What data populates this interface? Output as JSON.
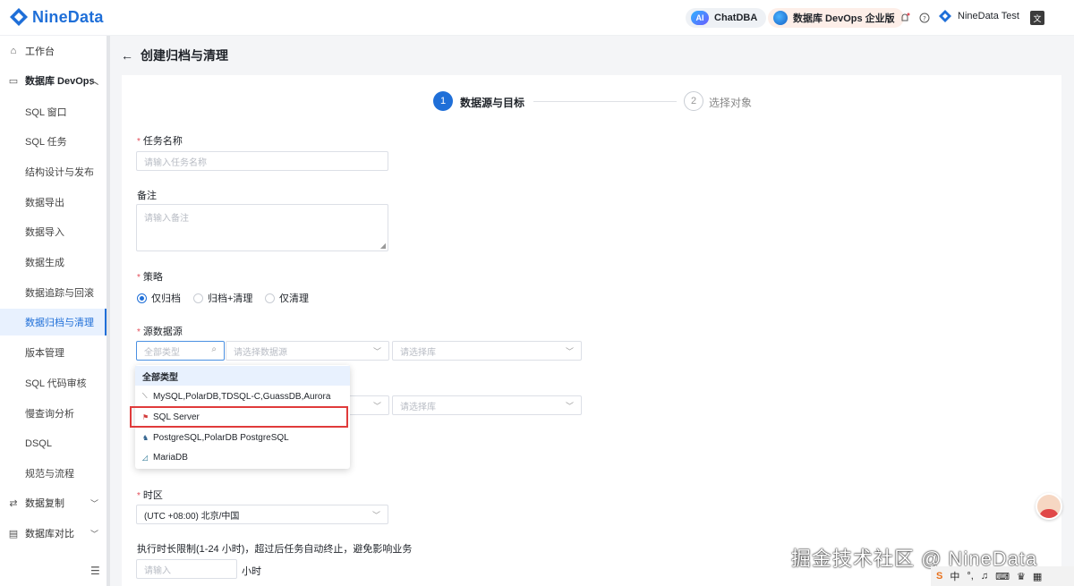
{
  "brand": {
    "name": "NineData"
  },
  "topbar": {
    "chatdba_badge": "AI",
    "chatdba_label": "ChatDBA",
    "edition_label": "数据库 DevOps 企业版",
    "user_name": "NineData Test",
    "lang_badge": "文"
  },
  "sidebar": {
    "items": [
      {
        "label": "工作台"
      },
      {
        "label": "数据库 DevOps"
      },
      {
        "label": "SQL 窗口"
      },
      {
        "label": "SQL 任务"
      },
      {
        "label": "结构设计与发布"
      },
      {
        "label": "数据导出"
      },
      {
        "label": "数据导入"
      },
      {
        "label": "数据生成"
      },
      {
        "label": "数据追踪与回滚"
      },
      {
        "label": "数据归档与清理"
      },
      {
        "label": "版本管理"
      },
      {
        "label": "SQL 代码审核"
      },
      {
        "label": "慢查询分析"
      },
      {
        "label": "DSQL"
      },
      {
        "label": "规范与流程"
      },
      {
        "label": "数据复制"
      },
      {
        "label": "数据库对比"
      }
    ]
  },
  "page": {
    "title": "创建归档与清理",
    "steps": [
      {
        "num": "1",
        "label": "数据源与目标"
      },
      {
        "num": "2",
        "label": "选择对象"
      }
    ]
  },
  "form": {
    "task_name_label": "任务名称",
    "task_name_placeholder": "请输入任务名称",
    "remark_label": "备注",
    "remark_placeholder": "请输入备注",
    "strategy_label": "策略",
    "strategy_options": [
      "仅归档",
      "归档+清理",
      "仅清理"
    ],
    "strategy_selected": "仅归档",
    "source_label": "源数据源",
    "type_placeholder": "全部类型",
    "datasource_placeholder": "请选择数据源",
    "db_placeholder": "请选择库",
    "db2_placeholder": "请选择库",
    "timezone_label": "时区",
    "timezone_value": "(UTC +08:00) 北京/中国",
    "duration_label": "执行时长限制(1-24 小时)，超过后任务自动终止，避免影响业务",
    "duration_placeholder": "请输入",
    "duration_unit": "小时"
  },
  "dropdown": {
    "options": [
      "全部类型",
      "MySQL,PolarDB,TDSQL-C,GuassDB,Aurora",
      "SQL Server",
      "PostgreSQL,PolarDB PostgreSQL",
      "MariaDB"
    ],
    "selected": "全部类型",
    "highlighted": "SQL Server"
  },
  "overlay": {
    "watermark": "掘金技术社区 @ NineData",
    "ime_text": "中"
  },
  "colors": {
    "accent": "#1f6fd8",
    "highlight": "#e03b3b"
  }
}
